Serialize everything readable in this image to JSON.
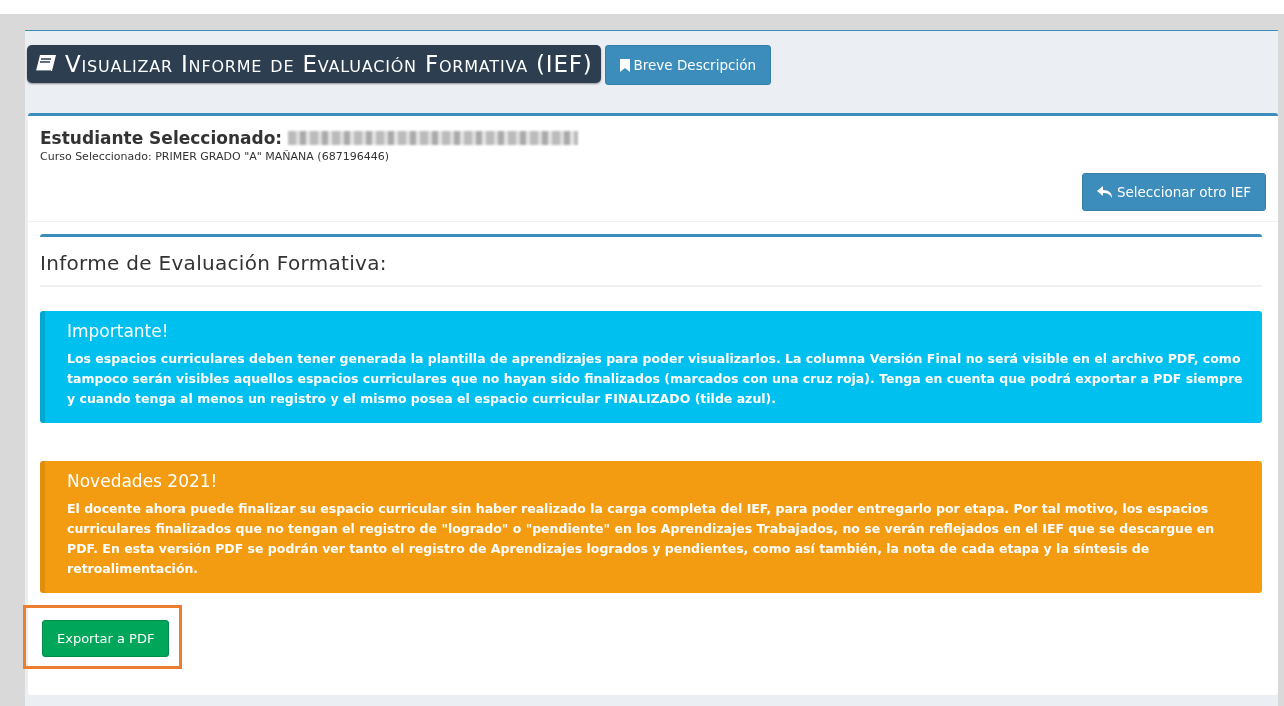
{
  "header": {
    "title": "Visualizar Informe de Evaluación Formativa (IEF)",
    "description_button": "Breve Descripción"
  },
  "student": {
    "label": "Estudiante Seleccionado:",
    "name_redacted": true,
    "course": "Curso Seleccionado: PRIMER GRADO \"A\" MAÑANA (687196446)",
    "change_button": "Seleccionar otro IEF"
  },
  "report": {
    "title": "Informe de Evaluación Formativa:",
    "alerts": [
      {
        "kind": "info",
        "title": "Importante!",
        "text": "Los espacios curriculares deben tener generada la plantilla de aprendizajes para poder visualizarlos. La columna Versión Final no será visible en el archivo PDF, como tampoco serán visibles aquellos espacios curriculares que no hayan sido finalizados (marcados con una cruz roja). Tenga en cuenta que podrá exportar a PDF siempre y cuando tenga al menos un registro y el mismo posea el espacio curricular FINALIZADO (tilde azul)."
      },
      {
        "kind": "warning",
        "title": "Novedades 2021!",
        "text": "El docente ahora puede finalizar su espacio curricular sin haber realizado la carga completa del IEF, para poder entregarlo por etapa. Por tal motivo, los espacios curriculares finalizados que no tengan el registro de \"logrado\" o \"pendiente\" en los Aprendizajes Trabajados, no se verán reflejados en el IEF que se descargue en PDF. En esta versión PDF se podrán ver tanto el registro de Aprendizajes logrados y pendientes, como así también, la nota de cada etapa y la síntesis de retroalimentación."
      }
    ],
    "export_button": {
      "label": "Exportar a PDF",
      "highlighted": true
    }
  }
}
